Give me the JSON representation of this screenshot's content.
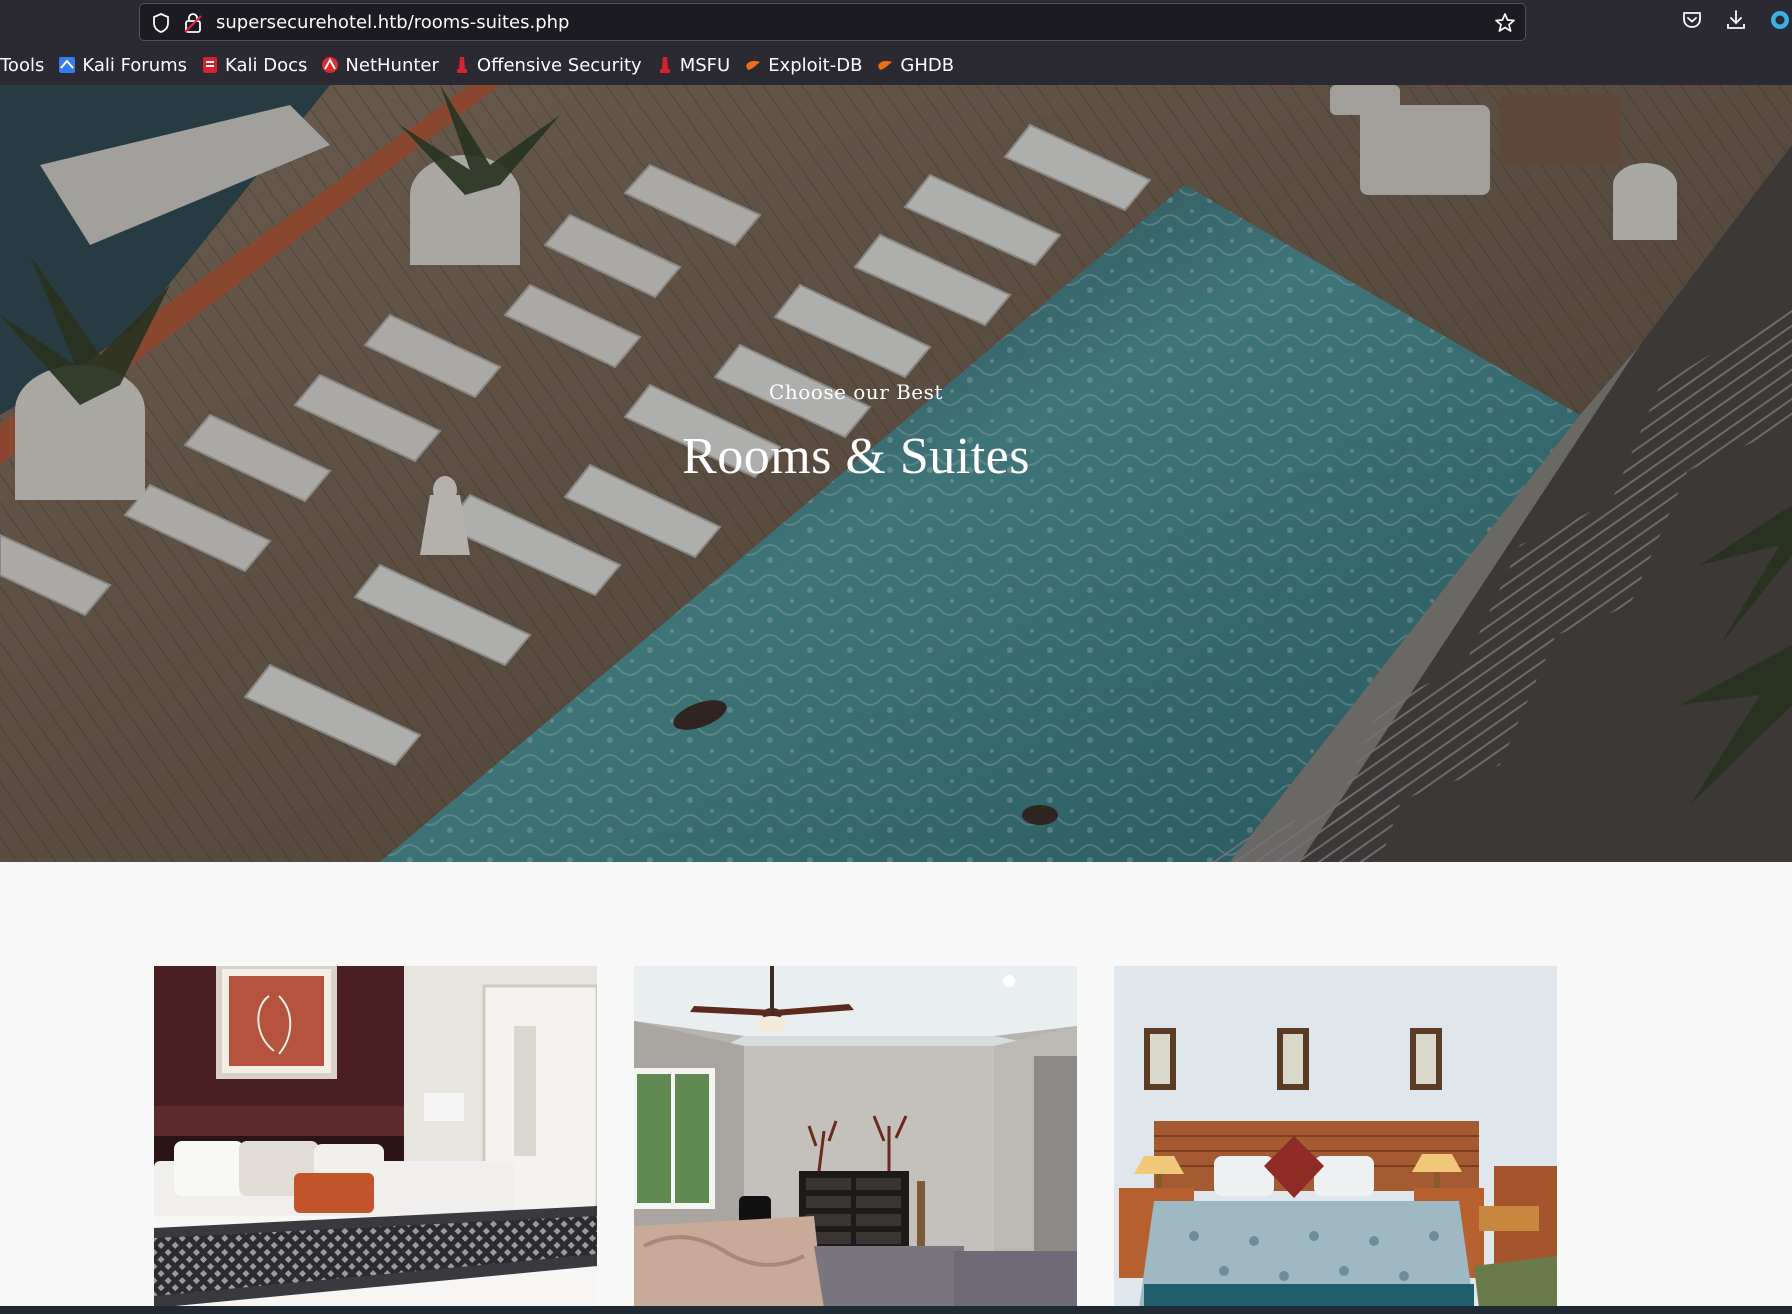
{
  "browser": {
    "url": "supersecurehotel.htb/rooms-suites.php",
    "bookmarks": [
      {
        "label": "Tools",
        "icon": "none"
      },
      {
        "label": "Kali Forums",
        "icon": "kali-forums-icon"
      },
      {
        "label": "Kali Docs",
        "icon": "kali-docs-icon"
      },
      {
        "label": "NetHunter",
        "icon": "nethunter-icon"
      },
      {
        "label": "Offensive Security",
        "icon": "offensive-security-icon"
      },
      {
        "label": "MSFU",
        "icon": "msfu-icon"
      },
      {
        "label": "Exploit-DB",
        "icon": "exploit-db-icon"
      },
      {
        "label": "GHDB",
        "icon": "ghdb-icon"
      }
    ]
  },
  "hero": {
    "subtitle": "Choose our Best",
    "title": "Rooms & Suites"
  },
  "rooms": [
    {
      "name": "room-card-1",
      "icon": "bedroom-photo"
    },
    {
      "name": "room-card-2",
      "icon": "bedroom-photo"
    },
    {
      "name": "room-card-3",
      "icon": "bedroom-photo"
    }
  ],
  "colors": {
    "chrome_bg": "#2b2a33",
    "url_bg": "#1c1b22",
    "page_bg": "#f8f8f8",
    "pool": "#3c7f86"
  }
}
